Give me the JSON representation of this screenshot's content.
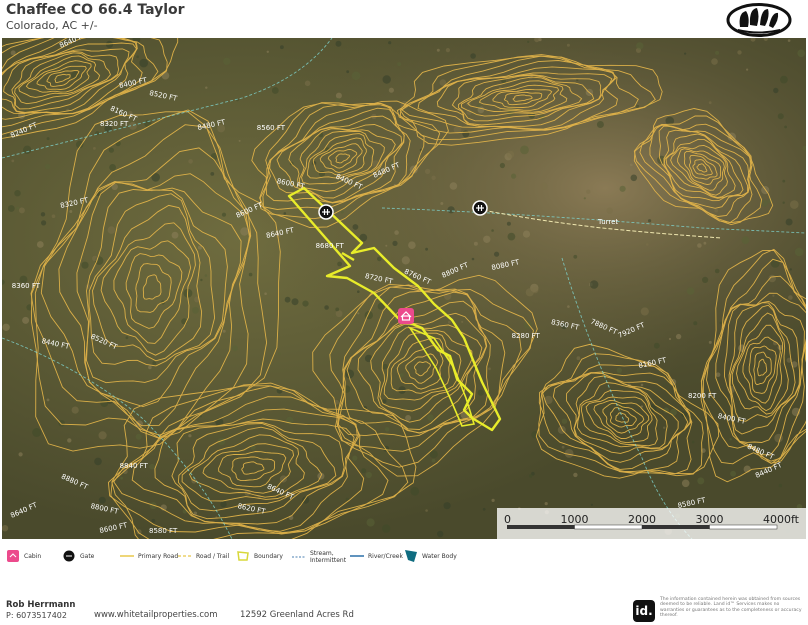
{
  "header": {
    "title": "Chaffee CO 66.4 Taylor",
    "subtitle": "Colorado,  AC +/-"
  },
  "map": {
    "place_label": "Turret",
    "contour_labels": [
      "8640 FT",
      "8400 FT",
      "8320 FT",
      "8520 FT",
      "8160 FT",
      "8240 FT",
      "8480 FT",
      "8560 FT",
      "8600 FT",
      "8400 FT",
      "8480 FT",
      "8320 FT",
      "8360 FT",
      "8440 FT",
      "8520 FT",
      "8600 FT",
      "8640 FT",
      "8680 FT",
      "8720 FT",
      "8760 FT",
      "8800 FT",
      "8080 FT",
      "8280 FT",
      "8360 FT",
      "7880 FT",
      "7920 FT",
      "8160 FT",
      "8200 FT",
      "8400 FT",
      "8480 FT",
      "8440 FT",
      "8580 FT",
      "8840 FT",
      "8800 FT",
      "8880 FT",
      "8640 FT",
      "8600 FT",
      "8580 FT",
      "8620 FT",
      "8640 FT"
    ],
    "markers": [
      {
        "type": "gate",
        "icon": "gate-icon"
      },
      {
        "type": "gate",
        "icon": "gate-icon"
      },
      {
        "type": "cabin",
        "icon": "cabin-icon"
      }
    ],
    "colors": {
      "contour": "#e8b84a",
      "boundary": "#e8ec2a",
      "road": "#f0e060",
      "stream": "#7fd6d0",
      "cabin": "#ec4a8c",
      "water_body": "#0f6c80"
    }
  },
  "scale_bar": {
    "ticks": [
      "0",
      "1000",
      "2000",
      "3000",
      "4000ft"
    ]
  },
  "legend": [
    {
      "label": "Cabin",
      "icon": "cabin-icon"
    },
    {
      "label": "Gate",
      "icon": "gate-icon"
    },
    {
      "label": "Primary Road",
      "icon": "primary-road-icon"
    },
    {
      "label": "Road / Trail",
      "icon": "road-trail-icon"
    },
    {
      "label": "Boundary",
      "icon": "boundary-icon"
    },
    {
      "label": "Stream, Intermittent",
      "icon": "stream-intermittent-icon"
    },
    {
      "label": "River/Creek",
      "icon": "river-creek-icon"
    },
    {
      "label": "Water Body",
      "icon": "water-body-icon"
    }
  ],
  "footer": {
    "agent_name": "Rob Herrmann",
    "phone": "P: 6073517402",
    "website": "www.whitetailproperties.com",
    "address": "12592 Greenland Acres Rd",
    "brand_mark": "id.",
    "disclaimer": "The information contained herein was obtained from sources deemed to be reliable. Land id™ Services makes no warranties or guarantees as to the completeness or accuracy thereof."
  }
}
